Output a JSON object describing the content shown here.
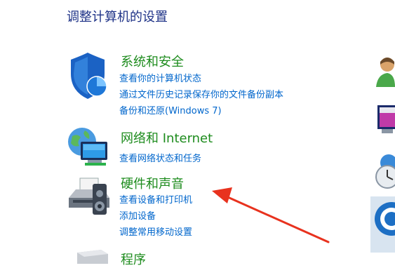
{
  "page": {
    "title": "调整计算机的设置"
  },
  "categories": [
    {
      "title": "系统和安全",
      "icon": "shield-icon",
      "links": [
        "查看你的计算机状态",
        "通过文件历史记录保存你的文件备份副本",
        "备份和还原(Windows 7)"
      ]
    },
    {
      "title": "网络和 Internet",
      "icon": "network-globe-icon",
      "links": [
        "查看网络状态和任务"
      ]
    },
    {
      "title": "硬件和声音",
      "icon": "printer-speaker-icon",
      "links": [
        "查看设备和打印机",
        "添加设备",
        "调整常用移动设置"
      ]
    },
    {
      "title": "程序",
      "icon": "programs-icon",
      "links": []
    }
  ],
  "right_column_icons": [
    "user-accounts-icon",
    "appearance-icon",
    "clock-globe-icon",
    "ease-of-access-icon"
  ],
  "annotation": {
    "type": "red-arrow",
    "color": "#e8321e",
    "points_to": "硬件和声音"
  },
  "colors": {
    "category_title": "#1e8c1e",
    "link": "#0066cc",
    "page_title": "#1e3287"
  }
}
